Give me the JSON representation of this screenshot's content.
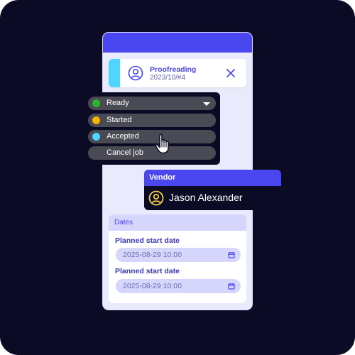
{
  "job": {
    "title": "Proofreading",
    "id": "2023/10/#4",
    "icon": "user-circle-icon",
    "close_icon": "close-icon"
  },
  "status_menu": {
    "items": [
      {
        "label": "Ready",
        "color": "#2bb52b",
        "selected": true
      },
      {
        "label": "Started",
        "color": "#f5b400"
      },
      {
        "label": "Accepted",
        "color": "#4fd5ff"
      },
      {
        "label": "Cancel job"
      }
    ]
  },
  "vendor": {
    "header": "Vendor",
    "name": "Jason Alexander",
    "icon": "user-circle-icon"
  },
  "dates": {
    "header": "Dates",
    "fields": [
      {
        "label": "Planned start date",
        "value": "2025-08-29 10:00",
        "icon": "calendar-icon"
      },
      {
        "label": "Planned start date",
        "value": "2025-08-29 10:00",
        "icon": "calendar-icon"
      }
    ]
  },
  "colors": {
    "background": "#0c0b26",
    "accent": "#4a47f0",
    "panel": "#e9eafb",
    "highlight": "#4fd5ff"
  }
}
